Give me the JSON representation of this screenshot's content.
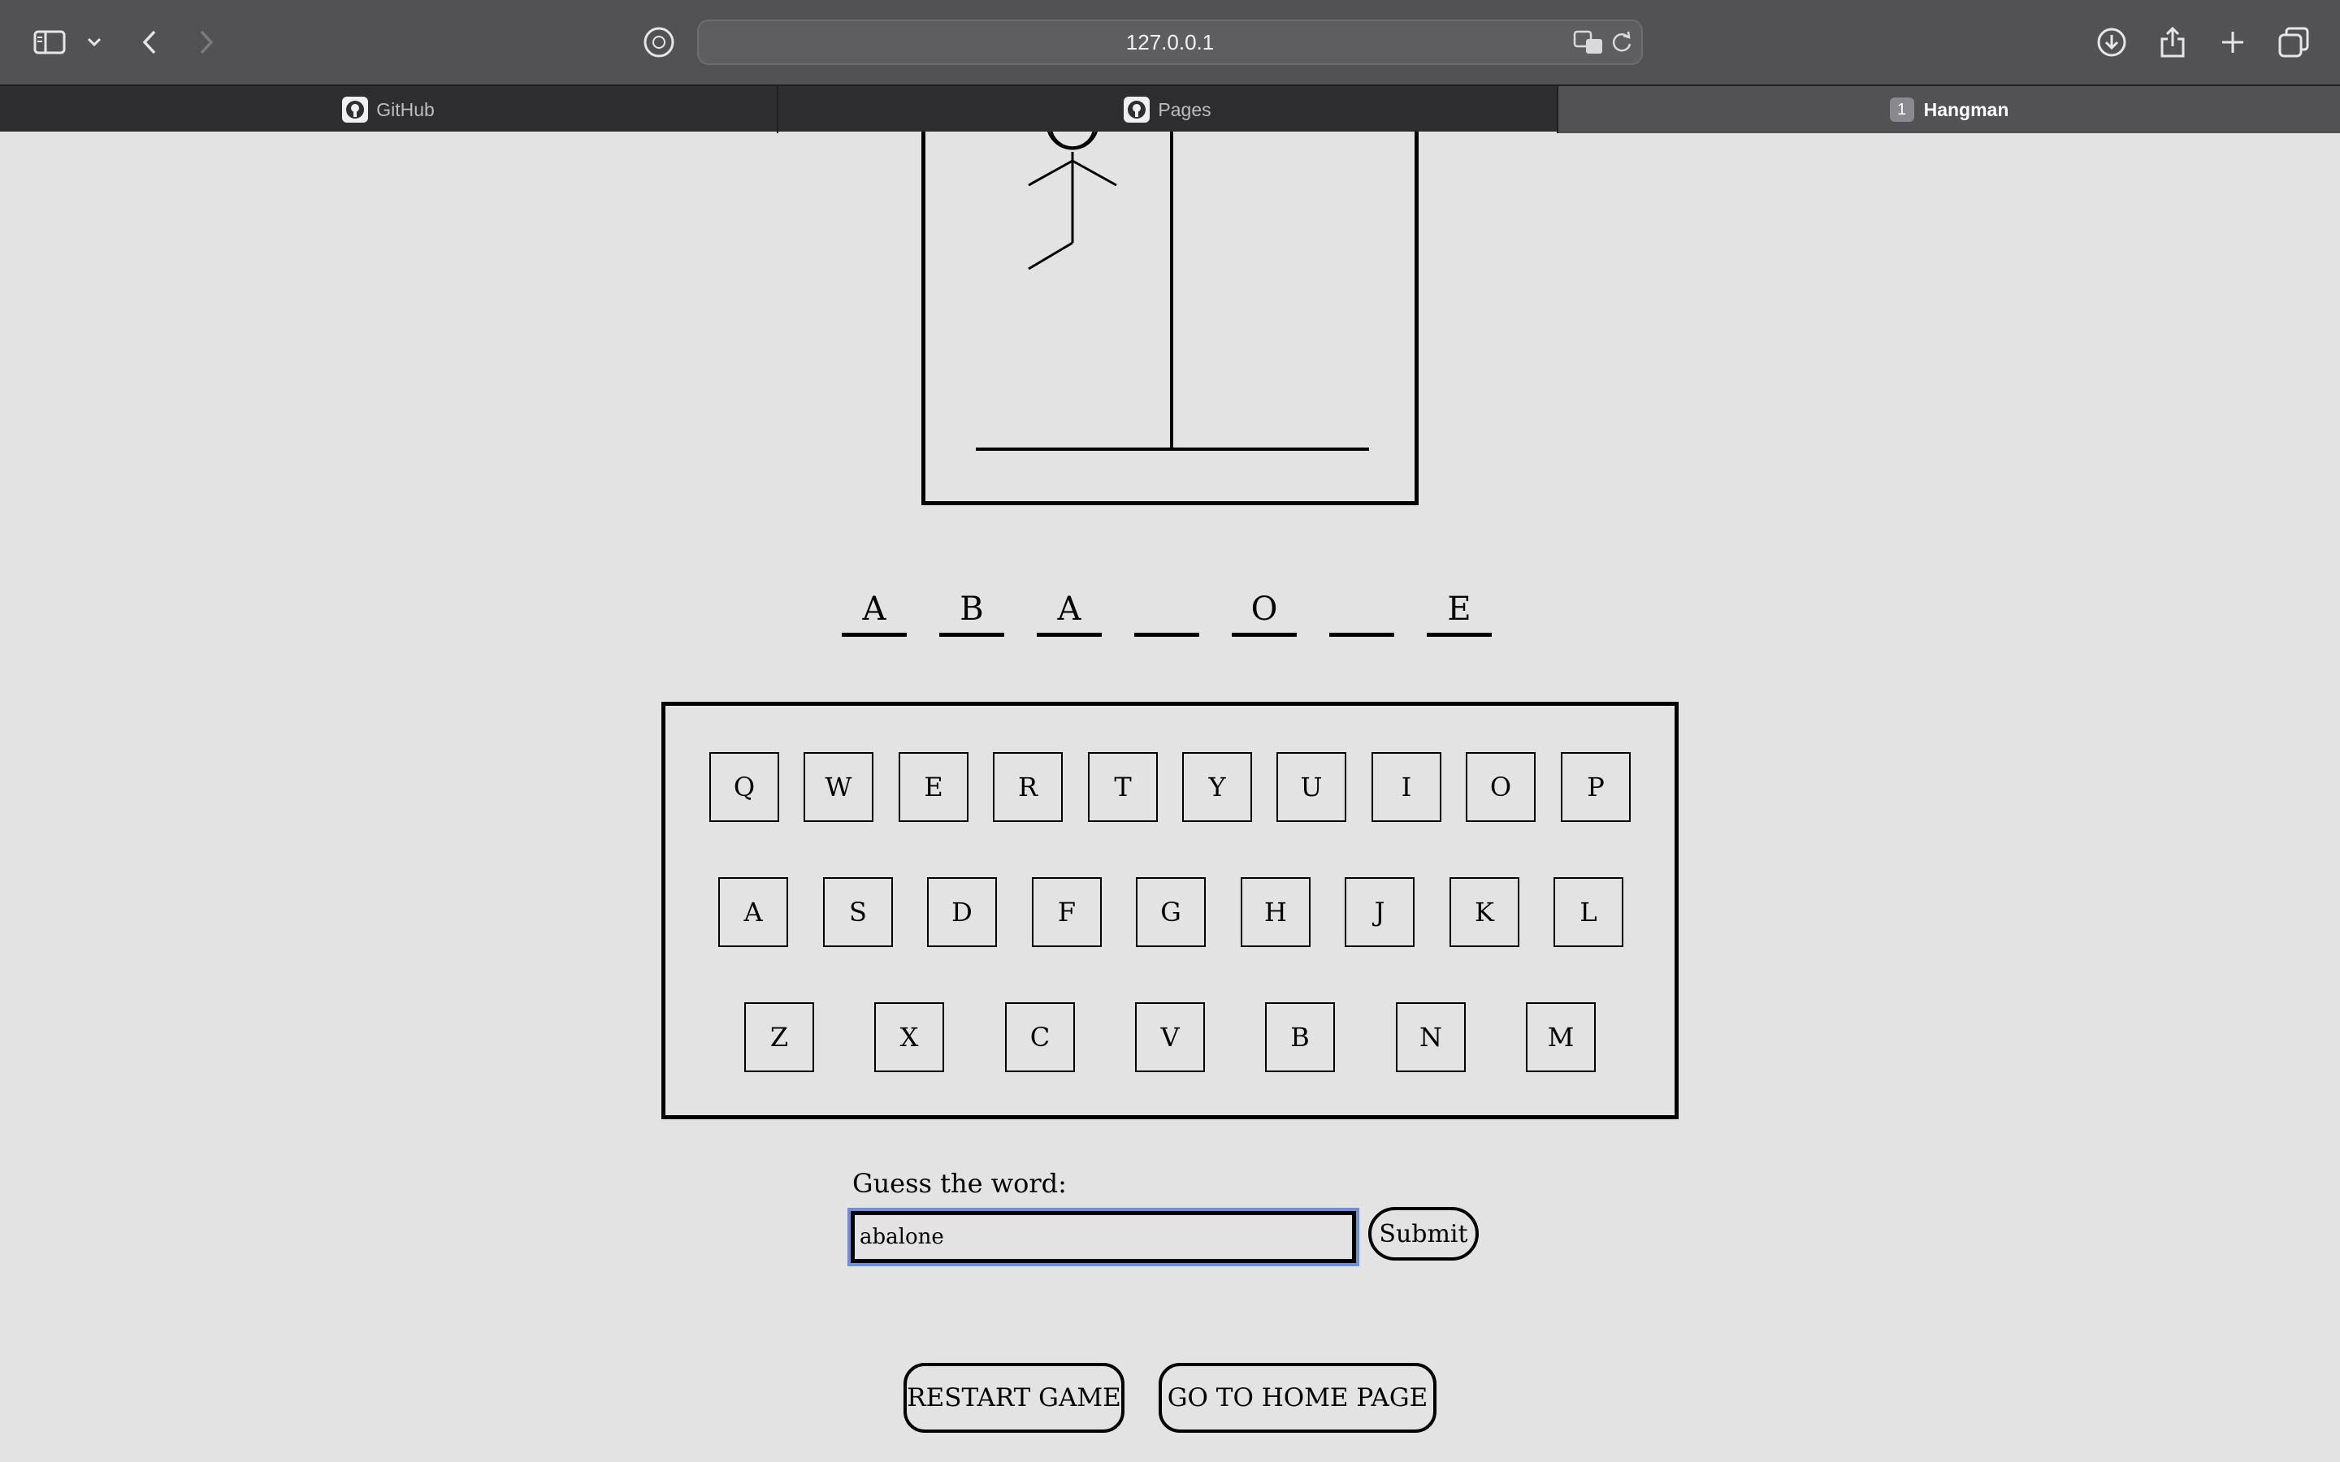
{
  "browser": {
    "url": "127.0.0.1",
    "icons": {
      "sidebar": "sidebar-icon",
      "back": "chevron-left-icon",
      "forward": "chevron-right-icon",
      "privacy": "duckduckgo-icon",
      "translate": "translate-icon",
      "reload": "reload-icon",
      "download": "download-icon",
      "share": "share-icon",
      "new_tab": "plus-icon",
      "tab_overview": "tabs-overview-icon"
    },
    "tabs": [
      {
        "label": "GitHub",
        "icon": "github-icon",
        "active": false
      },
      {
        "label": "Pages",
        "icon": "github-icon",
        "active": false
      },
      {
        "label": "Hangman",
        "badge": "1",
        "active": true
      }
    ]
  },
  "game": {
    "word_slots": [
      "A",
      "B",
      "A",
      "",
      "O",
      "",
      "E"
    ],
    "keyboard": {
      "row1": [
        "Q",
        "W",
        "E",
        "R",
        "T",
        "Y",
        "U",
        "I",
        "O",
        "P"
      ],
      "row2": [
        "A",
        "S",
        "D",
        "F",
        "G",
        "H",
        "J",
        "K",
        "L"
      ],
      "row3": [
        "Z",
        "X",
        "C",
        "V",
        "B",
        "N",
        "M"
      ]
    },
    "guess": {
      "label": "Guess the word:",
      "value": "abalone",
      "submit_label": "Submit"
    },
    "buttons": {
      "restart": "RESTART GAME",
      "home": "GO TO HOME PAGE"
    }
  }
}
